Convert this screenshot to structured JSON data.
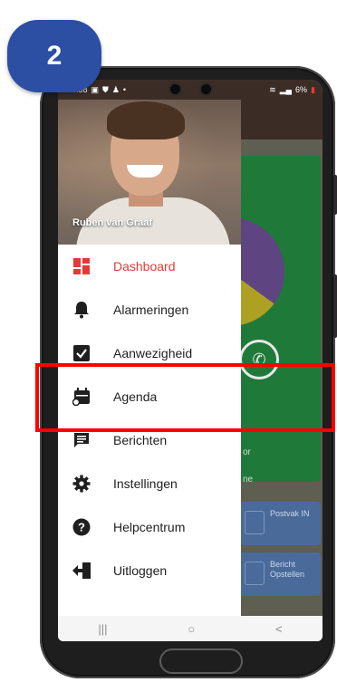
{
  "step_badge": "2",
  "statusbar": {
    "time": "16:38",
    "battery": "6%"
  },
  "profile": {
    "name": "Ruben van Graaf"
  },
  "menu": {
    "items": [
      {
        "label": "Dashboard",
        "icon": "dashboard-icon",
        "active": true
      },
      {
        "label": "Alarmeringen",
        "icon": "bell-icon",
        "active": false
      },
      {
        "label": "Aanwezigheid",
        "icon": "checkbox-icon",
        "active": false
      },
      {
        "label": "Agenda",
        "icon": "calendar-icon",
        "active": false
      },
      {
        "label": "Berichten",
        "icon": "message-icon",
        "active": false
      },
      {
        "label": "Instellingen",
        "icon": "gear-icon",
        "active": false
      },
      {
        "label": "Helpcentrum",
        "icon": "help-icon",
        "active": false
      },
      {
        "label": "Uitloggen",
        "icon": "logout-icon",
        "active": false
      }
    ]
  },
  "background_app": {
    "text_1": "or",
    "text_2": "ne",
    "tile_1": "Postvak IN",
    "tile_2": "Bericht Opstellen"
  },
  "navbar": {
    "recent": "|||",
    "home": "○",
    "back": "<"
  },
  "colors": {
    "accent_red": "#e53935",
    "highlight": "#ff0000",
    "badge": "#2c4ea3"
  }
}
